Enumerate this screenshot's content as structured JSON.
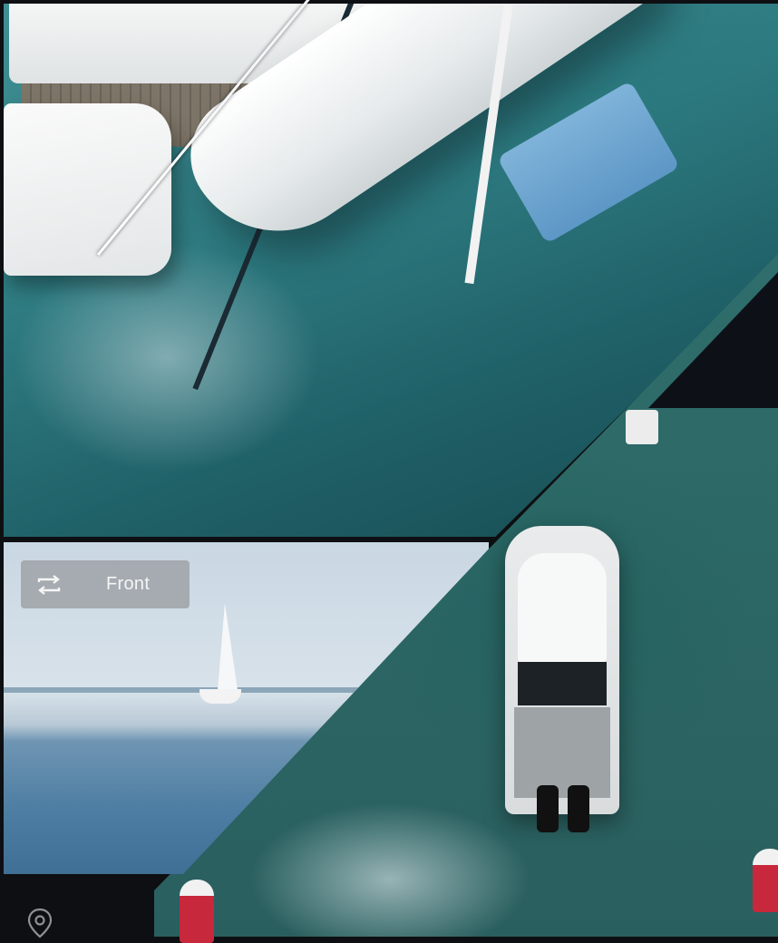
{
  "camera_switch": {
    "label": "Front",
    "icon": "repeat-arrows-icon"
  },
  "footer": {
    "icon": "location-pin-icon"
  },
  "colors": {
    "pill_background": "#96989b",
    "pill_text": "#f5f5f5",
    "app_background": "#0e0f12",
    "divider": "#ffffff"
  }
}
